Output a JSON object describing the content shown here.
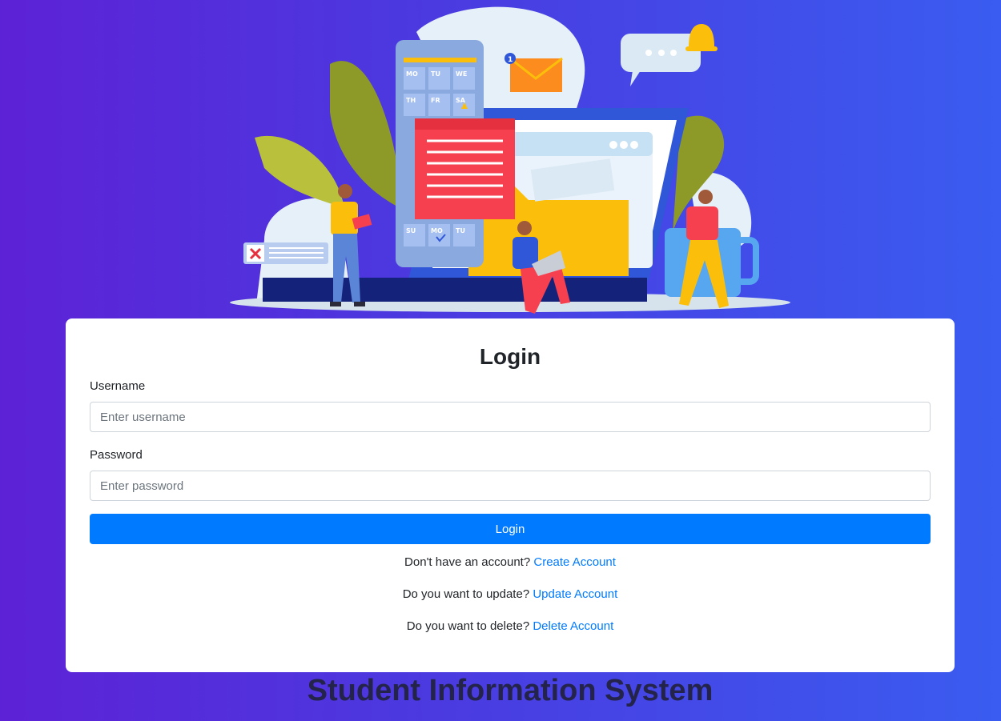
{
  "login": {
    "title": "Login",
    "username_label": "Username",
    "username_placeholder": "Enter username",
    "password_label": "Password",
    "password_placeholder": "Enter password",
    "button_label": "Login",
    "create": {
      "text": "Don't have an account?",
      "link": "Create Account"
    },
    "update": {
      "text": "Do you want to update?",
      "link": "Update Account"
    },
    "delete": {
      "text": "Do you want to delete?",
      "link": "Delete Account"
    }
  },
  "footer_title": "Student Information System",
  "illustration": {
    "calendar_days": [
      "MO",
      "TU",
      "WE",
      "TH",
      "FR",
      "SA",
      "SU",
      "MO",
      "TU"
    ],
    "mail_badge": "1"
  },
  "colors": {
    "primary": "#007bff",
    "bg_start": "#5d22d6",
    "bg_end": "#3a5cf0"
  }
}
